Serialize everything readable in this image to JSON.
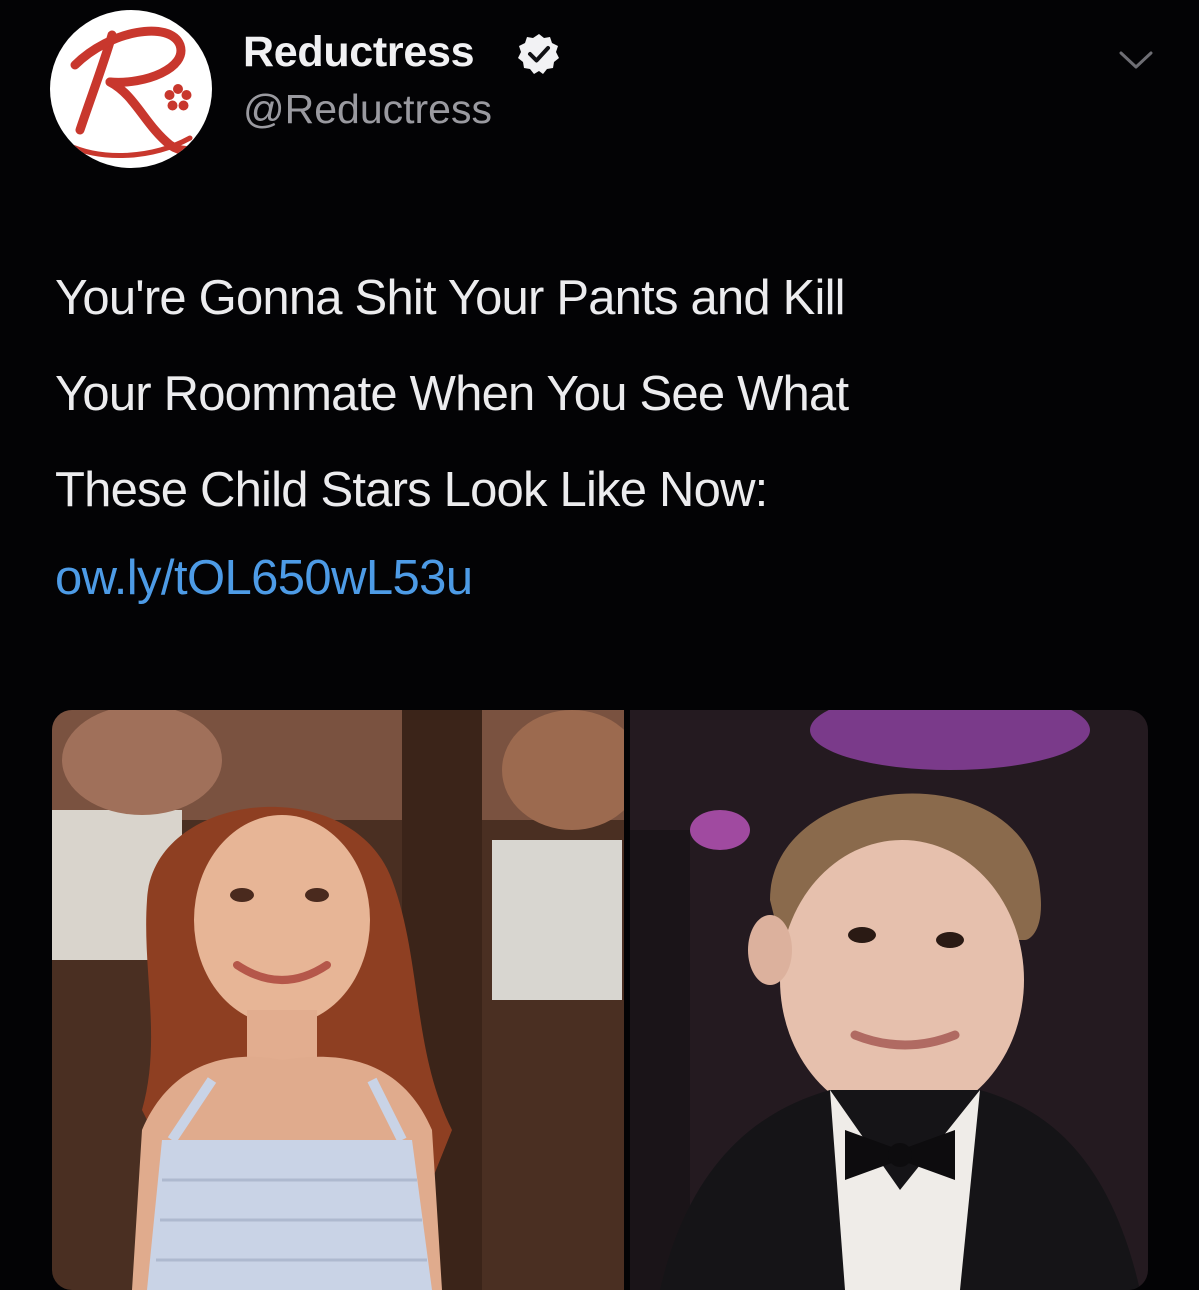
{
  "tweet": {
    "author": {
      "display_name": "Reductress",
      "handle": "@Reductress",
      "verified": true,
      "avatar_icon": "reductress-logo-icon",
      "avatar_letter": "R"
    },
    "text_lines": [
      "You're Gonna Shit Your Pants and Kill",
      "Your Roommate When You See What",
      "These Child Stars Look Like Now:"
    ],
    "link": "ow.ly/tOL650wL53u",
    "menu_icon": "chevron-down-icon",
    "media": [
      {
        "name": "photo-girl-red-hair"
      },
      {
        "name": "photo-boy-tuxedo"
      }
    ]
  },
  "colors": {
    "background": "#030305",
    "text": "#ececee",
    "secondary_text": "#9a9aa0",
    "link": "#4d9be6",
    "brand": "#c8372d"
  }
}
